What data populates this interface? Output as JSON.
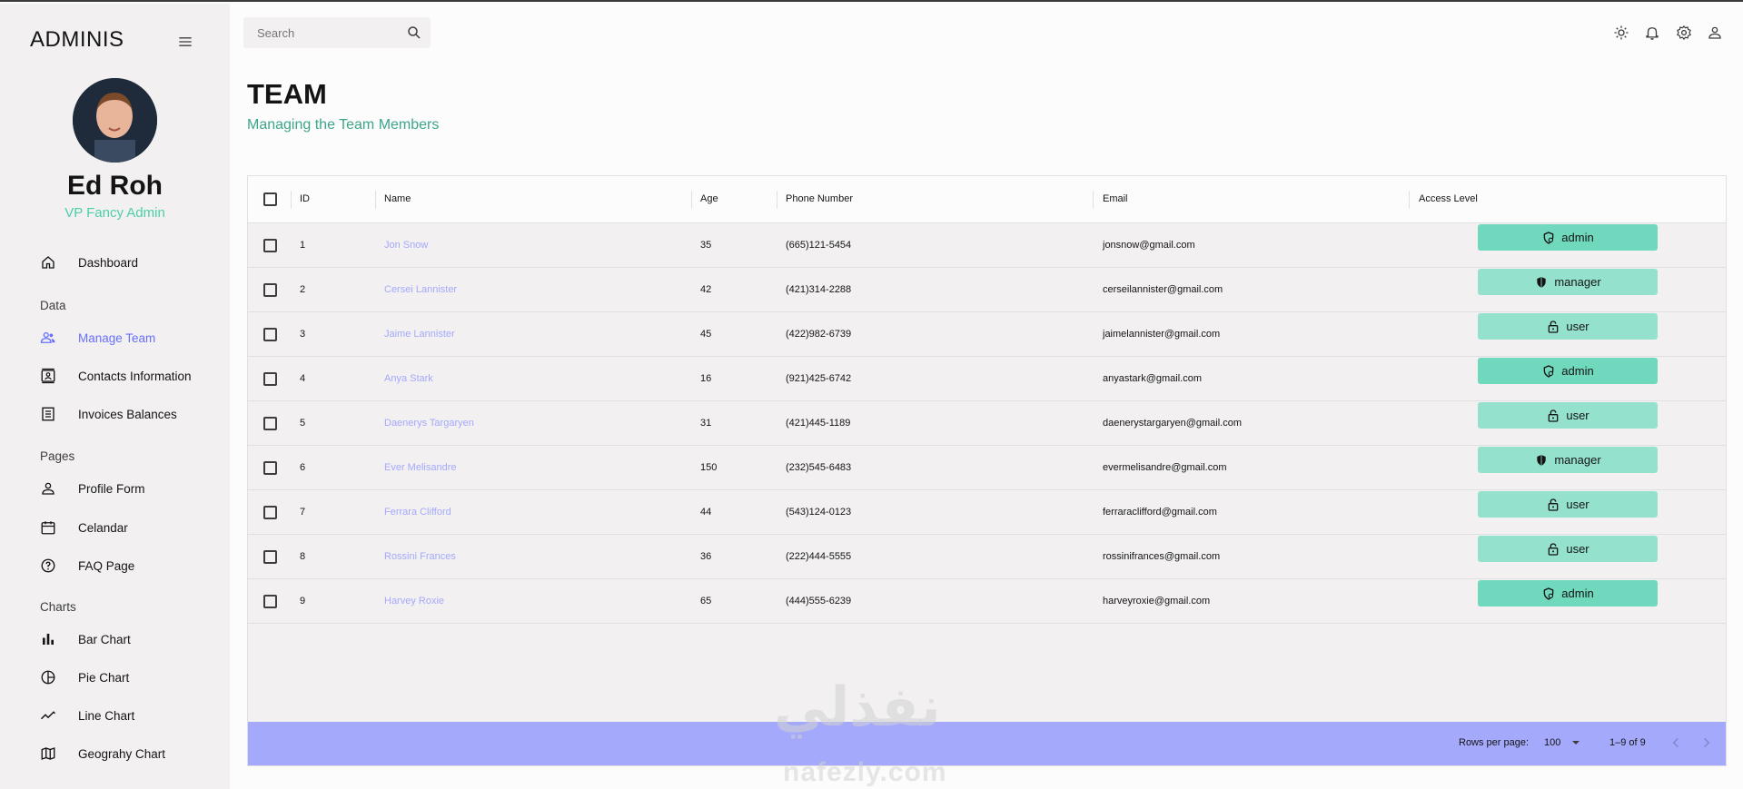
{
  "sidebar": {
    "brand": "ADMINIS",
    "user_name": "Ed Roh",
    "user_role": "VP Fancy Admin",
    "items": [
      {
        "label": "Dashboard",
        "icon": "home-icon"
      },
      {
        "label": "Manage Team",
        "icon": "people-icon",
        "active": true
      },
      {
        "label": "Contacts Information",
        "icon": "contacts-icon"
      },
      {
        "label": "Invoices Balances",
        "icon": "receipt-icon"
      },
      {
        "label": "Profile Form",
        "icon": "person-icon"
      },
      {
        "label": "Celandar",
        "icon": "calendar-icon"
      },
      {
        "label": "FAQ Page",
        "icon": "help-icon"
      },
      {
        "label": "Bar Chart",
        "icon": "bar-chart-icon"
      },
      {
        "label": "Pie Chart",
        "icon": "pie-chart-icon"
      },
      {
        "label": "Line Chart",
        "icon": "line-chart-icon"
      },
      {
        "label": "Geograhy Chart",
        "icon": "map-icon"
      }
    ],
    "sections": [
      "Data",
      "Pages",
      "Charts"
    ]
  },
  "topbar": {
    "search_placeholder": "Search",
    "icons": [
      "light-mode-icon",
      "notifications-icon",
      "settings-icon",
      "person-icon"
    ]
  },
  "header": {
    "title": "TEAM",
    "subtitle": "Managing the Team Members"
  },
  "grid": {
    "columns": [
      "ID",
      "Name",
      "Age",
      "Phone Number",
      "Email",
      "Access Level"
    ],
    "rows": [
      {
        "id": "1",
        "name": "Jon Snow",
        "age": "35",
        "phone": "(665)121-5454",
        "email": "jonsnow@gmail.com",
        "access": "admin"
      },
      {
        "id": "2",
        "name": "Cersei Lannister",
        "age": "42",
        "phone": "(421)314-2288",
        "email": "cerseilannister@gmail.com",
        "access": "manager"
      },
      {
        "id": "3",
        "name": "Jaime Lannister",
        "age": "45",
        "phone": "(422)982-6739",
        "email": "jaimelannister@gmail.com",
        "access": "user"
      },
      {
        "id": "4",
        "name": "Anya Stark",
        "age": "16",
        "phone": "(921)425-6742",
        "email": "anyastark@gmail.com",
        "access": "admin"
      },
      {
        "id": "5",
        "name": "Daenerys Targaryen",
        "age": "31",
        "phone": "(421)445-1189",
        "email": "daenerystargaryen@gmail.com",
        "access": "user"
      },
      {
        "id": "6",
        "name": "Ever Melisandre",
        "age": "150",
        "phone": "(232)545-6483",
        "email": "evermelisandre@gmail.com",
        "access": "manager"
      },
      {
        "id": "7",
        "name": "Ferrara Clifford",
        "age": "44",
        "phone": "(543)124-0123",
        "email": "ferraraclifford@gmail.com",
        "access": "user"
      },
      {
        "id": "8",
        "name": "Rossini Frances",
        "age": "36",
        "phone": "(222)444-5555",
        "email": "rossinifrances@gmail.com",
        "access": "user"
      },
      {
        "id": "9",
        "name": "Harvey Roxie",
        "age": "65",
        "phone": "(444)555-6239",
        "email": "harveyroxie@gmail.com",
        "access": "admin"
      }
    ],
    "footer": {
      "rows_per_page_label": "Rows per page:",
      "rows_per_page_value": "100",
      "range": "1–9 of 9"
    }
  },
  "watermark": {
    "arabic": "نفذلي",
    "latin": "nafezly.com"
  },
  "colors": {
    "accent": "#6870fa",
    "green": "#4cceac",
    "subtitle_green": "#3da58a",
    "admin_bg": "#70d8bd",
    "role_bg": "#94e2cd",
    "footer_bg": "#a4a9fc",
    "name_link": "#a4a9fc"
  }
}
